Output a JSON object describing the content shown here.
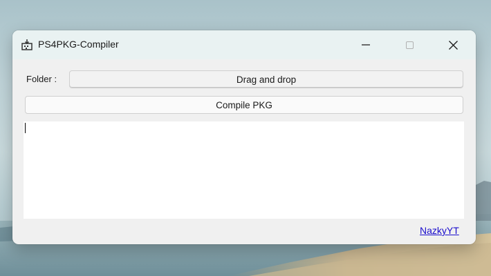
{
  "window": {
    "title": "PS4PKG-Compiler"
  },
  "icons": {
    "app": "package-icon",
    "minimize": "minimize-icon",
    "maximize": "maximize-icon",
    "close": "close-icon"
  },
  "form": {
    "folder_label": "Folder :",
    "drag_button_label": "Drag and drop",
    "compile_button_label": "Compile PKG",
    "log_text": ""
  },
  "footer": {
    "author_link": "NazkyYT"
  },
  "colors": {
    "link": "#1a0dcc",
    "titlebar": "#e9f2f2",
    "window_bg": "#f0f0f0"
  }
}
